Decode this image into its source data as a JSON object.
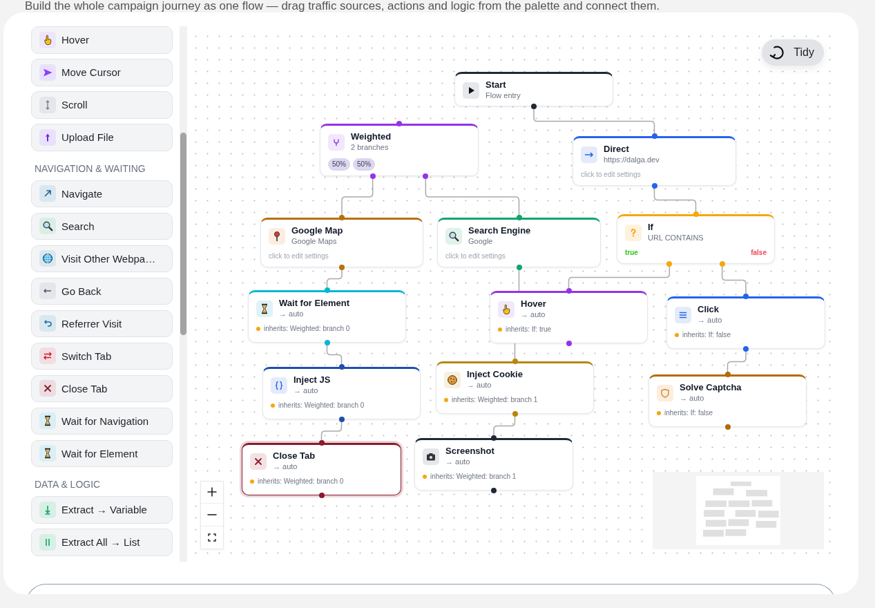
{
  "intro": {
    "text": "Build the whole campaign journey as one flow — drag traffic sources, actions and logic from the palette and connect them."
  },
  "palette": {
    "sections": [
      {
        "items": [
          {
            "kind": "hover",
            "label": "Hover"
          },
          {
            "kind": "move_cursor",
            "label": "Move Cursor"
          },
          {
            "kind": "scroll",
            "label": "Scroll"
          },
          {
            "kind": "upload",
            "label": "Upload File"
          }
        ]
      },
      {
        "heading": "NAVIGATION & WAITING",
        "items": [
          {
            "kind": "navigate",
            "label": "Navigate"
          },
          {
            "kind": "search",
            "label": "Search"
          },
          {
            "kind": "visit",
            "label": "Visit Other Webpa…"
          },
          {
            "kind": "back",
            "label": "Go Back"
          },
          {
            "kind": "referrer",
            "label": "Referrer Visit"
          },
          {
            "kind": "switch_tab",
            "label": "Switch Tab"
          },
          {
            "kind": "close_tab",
            "label": "Close Tab"
          },
          {
            "kind": "wait_navigation",
            "label": "Wait for Navigation"
          },
          {
            "kind": "wait_element",
            "label": "Wait for Element"
          }
        ]
      },
      {
        "heading": "DATA & LOGIC",
        "items": [
          {
            "kind": "extract",
            "label": "Extract → Variable"
          },
          {
            "kind": "extract_all",
            "label": "Extract All → List"
          }
        ]
      }
    ]
  },
  "canvas": {
    "tidy_button": {
      "label": "Tidy"
    }
  },
  "flow": {
    "roots": [
      {
        "kind": "start",
        "title": "Start",
        "subtitle": "Flow entry",
        "selected": false,
        "next": [
          {
            "kind": "direct",
            "title": "Direct",
            "subtitle": "https://dalga.dev",
            "hint": "click to edit settings",
            "selected": false,
            "next": [
              {
                "kind": "if",
                "title": "If",
                "subtitle": "URL CONTAINS",
                "branches": [
                  {
                    "label": "true",
                    "color": "#35c21a"
                  },
                  {
                    "label": "false",
                    "color": "#f0475a"
                  }
                ],
                "selected": false,
                "next": [
                  {
                    "kind": "hover",
                    "title": "Hover",
                    "subtitle": "→ auto",
                    "inherits": "inherits: If: true",
                    "selected": false
                  },
                  {
                    "kind": "click",
                    "title": "Click",
                    "subtitle": "→ auto",
                    "inherits": "inherits: If: false",
                    "selected": false,
                    "next": [
                      {
                        "kind": "solve_captcha",
                        "title": "Solve Captcha",
                        "subtitle": "→ auto",
                        "inherits": "inherits: If: false",
                        "selected": false
                      }
                    ]
                  }
                ]
              }
            ]
          }
        ]
      },
      {
        "kind": "weighted",
        "title": "Weighted",
        "subtitle": "2 branches",
        "weights": [
          "50%",
          "50%"
        ],
        "selected": false,
        "next": [
          {
            "kind": "google_map",
            "title": "Google Map",
            "subtitle": "Google Maps",
            "hint": "click to edit settings",
            "selected": false,
            "next": [
              {
                "kind": "wait_element",
                "title": "Wait for Element",
                "subtitle": "→ auto",
                "inherits": "inherits: Weighted: branch 0",
                "selected": false,
                "next": [
                  {
                    "kind": "inject_js",
                    "title": "Inject JS",
                    "subtitle": "→ auto",
                    "inherits": "inherits: Weighted: branch 0",
                    "selected": false,
                    "next": [
                      {
                        "kind": "close_tab",
                        "title": "Close Tab",
                        "subtitle": "→ auto",
                        "inherits": "inherits: Weighted: branch 0",
                        "selected": true
                      }
                    ]
                  }
                ]
              }
            ]
          },
          {
            "kind": "search_engine",
            "title": "Search Engine",
            "subtitle": "Google",
            "hint": "click to edit settings",
            "selected": false,
            "next": [
              {
                "kind": "inject_cookie",
                "title": "Inject Cookie",
                "subtitle": "→ auto",
                "inherits": "inherits: Weighted: branch 1",
                "selected": false,
                "next": [
                  {
                    "kind": "screenshot",
                    "title": "Screenshot",
                    "subtitle": "→ auto",
                    "inherits": "inherits: Weighted: branch 1",
                    "selected": false
                  }
                ]
              }
            ]
          }
        ]
      }
    ]
  }
}
